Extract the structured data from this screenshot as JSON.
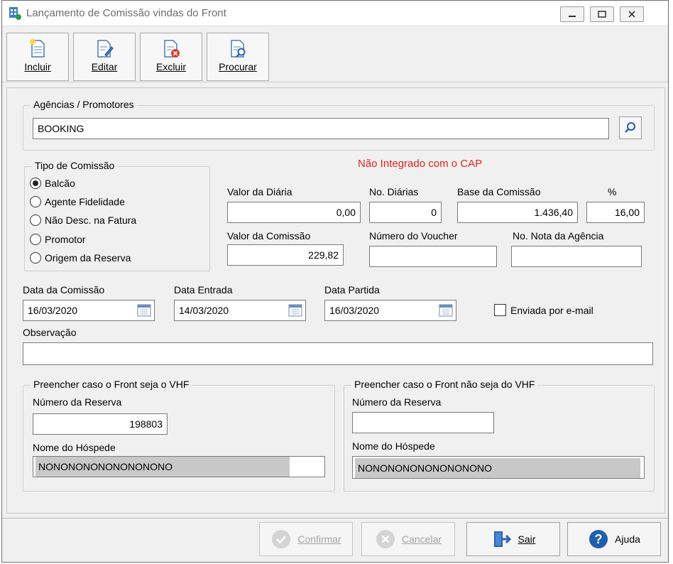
{
  "window": {
    "title": "Lançamento de Comissão vindas do Front"
  },
  "toolbar": {
    "incluir": "Incluir",
    "editar": "Editar",
    "excluir": "Excluir",
    "procurar": "Procurar"
  },
  "agencias": {
    "title": "Agências  / Promotores",
    "value": "BOOKING"
  },
  "tipo_comissao": {
    "title": "Tipo de Comissão",
    "options": [
      "Balcão",
      "Agente Fidelidade",
      "Não Desc. na Fatura",
      "Promotor",
      "Origem da Reserva"
    ],
    "selected": "Balcão"
  },
  "status": {
    "text": "Não Integrado com o CAP",
    "color": "#e8231b"
  },
  "valores": {
    "valor_diaria_label": "Valor da Diária",
    "valor_diaria": "0,00",
    "no_diarias_label": "No. Diárias",
    "no_diarias": "0",
    "base_comissao_label": "Base da Comissão",
    "base_comissao": "1.436,40",
    "pct_label": "%",
    "pct": "16,00",
    "valor_comissao_label": "Valor da Comissão",
    "valor_comissao": "229,82",
    "numero_voucher_label": "Número do Voucher",
    "numero_voucher": "",
    "nota_agencia_label": "No. Nota da Agência",
    "nota_agencia": ""
  },
  "datas": {
    "comissao_label": "Data da Comissão",
    "comissao": "16/03/2020",
    "entrada_label": "Data Entrada",
    "entrada": "14/03/2020",
    "partida_label": "Data Partida",
    "partida": "16/03/2020"
  },
  "email": {
    "label": "Enviada por e-mail",
    "checked": false
  },
  "observacao": {
    "label": "Observação",
    "value": ""
  },
  "vhf": {
    "title": "Preencher caso o Front seja o VHF",
    "reserva_label": "Número da Reserva",
    "reserva": "198803",
    "hospede_label": "Nome do Hóspede",
    "hospede": "NONONONONONONONONO"
  },
  "nao_vhf": {
    "title": "Preencher caso o Front não seja do VHF",
    "reserva_label": "Número da Reserva",
    "reserva": "",
    "hospede_label": "Nome do Hóspede",
    "hospede": "NONONONONONONONONO"
  },
  "buttons": {
    "confirmar": "Confirmar",
    "cancelar": "Cancelar",
    "sair": "Sair",
    "ajuda": "Ajuda"
  }
}
